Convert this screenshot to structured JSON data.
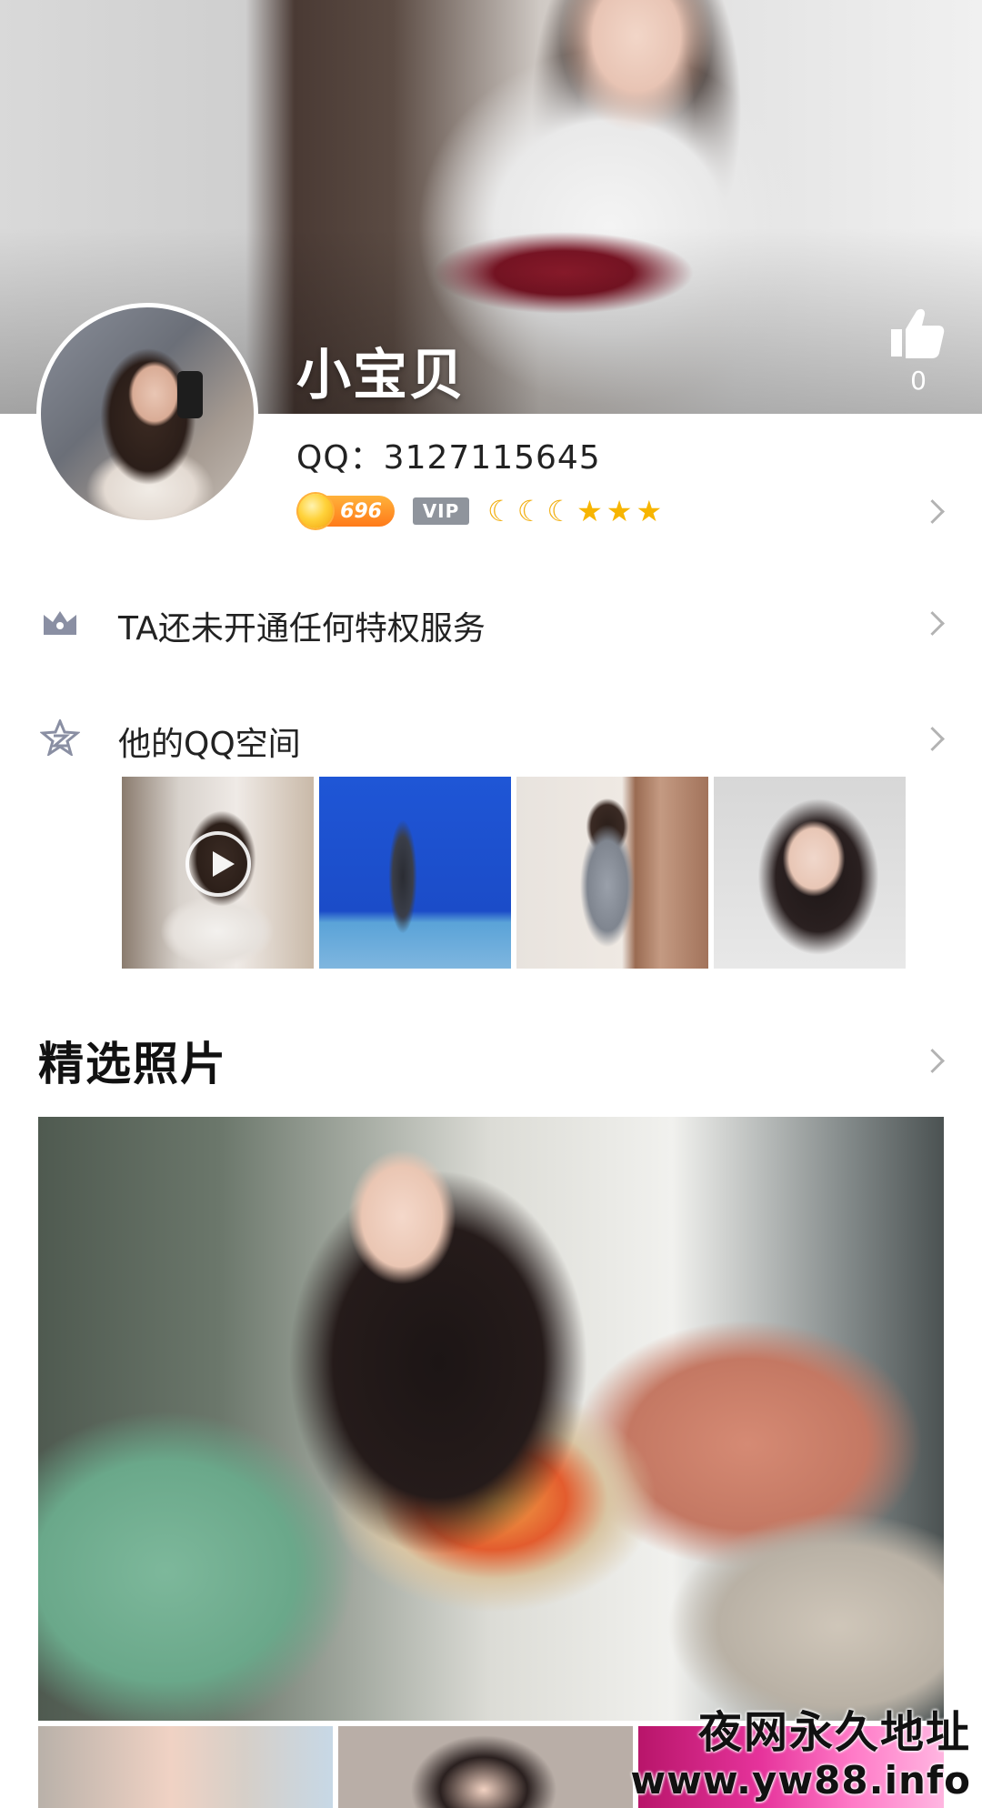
{
  "profile": {
    "name": "小宝贝",
    "qq_label": "QQ：3127115645",
    "like_count": "0",
    "level_number": "696",
    "vip_label": "VIP",
    "level_icons": [
      "moon",
      "moon",
      "moon",
      "star",
      "star",
      "star"
    ]
  },
  "privilege": {
    "label": "TA还未开通任何特权服务"
  },
  "qzone": {
    "label": "他的QQ空间",
    "thumbnails": [
      "video-thumbnail",
      "photo",
      "photo",
      "photo"
    ]
  },
  "featured": {
    "title": "精选照片"
  },
  "watermark": {
    "line1": "夜网永久地址",
    "line2": "www.yw88.info"
  },
  "colors": {
    "level_badge": "#ff7a1a",
    "vip_badge": "#8f949c",
    "moon": "#f2b116",
    "star": "#f7b500",
    "chevron": "#b3b3b3",
    "icon_gray": "#8a8fa3"
  }
}
